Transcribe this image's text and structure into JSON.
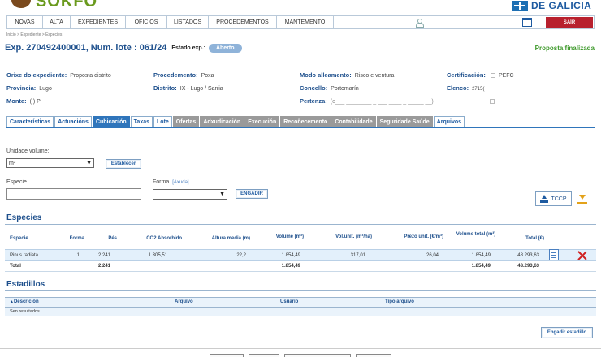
{
  "header": {
    "logo_left": "SOKFO",
    "logo_right": "DE GALICIA"
  },
  "menu": {
    "items": [
      "NOVAS",
      "ALTA",
      "EXPEDIENTES",
      "OFICIOS",
      "LISTADOS",
      "PROCEDEMENTOS",
      "MANTEMENTO"
    ],
    "logout": "SAÍR"
  },
  "breadcrumb": "Inicio > Expediente > Especies",
  "expediente": {
    "title": "Exp. 270492400001, Num. lote : 061/24",
    "estado_label": "Estado exp.:",
    "estado_value": "Aberto",
    "proposta": "Proposta finalizada"
  },
  "info": {
    "orixe_label": "Orixe do expediente:",
    "orixe_value": "Proposta distrito",
    "provincia_label": "Provincia:",
    "provincia_value": "Lugo",
    "monte_label": "Monte:",
    "monte_value": "(  ) P",
    "procedemento_label": "Procedemento:",
    "procedemento_value": "Poxa",
    "distrito_label": "Distrito:",
    "distrito_value": "IX - Lugo / Sarria",
    "modo_label": "Modo alleamento:",
    "modo_value": "Risco e ventura",
    "concello_label": "Concello:",
    "concello_value": "Portomarín",
    "pertenza_label": "Pertenza:",
    "pertenza_value": "(c___ ________ _ ___ ____ _ _____ __)",
    "certificacion_label": "Certificación:",
    "certificacion_value": "PEFC",
    "elenco_label": "Elenco:",
    "elenco_value": "2715("
  },
  "tabs": [
    {
      "label": "Características",
      "state": "link"
    },
    {
      "label": "Actuacións",
      "state": "link"
    },
    {
      "label": "Cubicación",
      "state": "active"
    },
    {
      "label": "Taxas",
      "state": "link"
    },
    {
      "label": "Lote",
      "state": "link"
    },
    {
      "label": "Ofertas",
      "state": "disabled"
    },
    {
      "label": "Adxudicación",
      "state": "disabled"
    },
    {
      "label": "Execución",
      "state": "disabled"
    },
    {
      "label": "Recoñecemento",
      "state": "disabled"
    },
    {
      "label": "Contabilidade",
      "state": "disabled"
    },
    {
      "label": "Seguridade Saúde",
      "state": "disabled"
    },
    {
      "label": "Arquivos",
      "state": "link"
    }
  ],
  "form": {
    "unidade_label": "Unidade volume:",
    "unidade_value": "m³",
    "establecer": "Establecer",
    "especie_label": "Especie",
    "forma_label": "Forma",
    "axuda": "[Axuda]",
    "engadir": "ENGADIR",
    "tccp": "TCCP"
  },
  "especies": {
    "title": "Especies",
    "headers": [
      "Especie",
      "Forma",
      "Pés",
      "CO2 Absorbido",
      "Altura media (m)",
      "Volume (m³)",
      "Vol.unit. (m³/ha)",
      "Prezo unit. (€/m³)",
      "Volume total (m³)",
      "Total (€)"
    ],
    "row": [
      "Pinus radiata",
      "1",
      "2.241",
      "1.305,51",
      "22,2",
      "1.854,49",
      "317,01",
      "26,04",
      "1.854,49",
      "48.293,63"
    ],
    "total": [
      "Total",
      "2.241",
      "1.854,49",
      "1.854,49",
      "48.293,63"
    ]
  },
  "estadillos": {
    "title": "Estadillos",
    "headers": [
      "Descrición",
      "Arquivo",
      "Usuario",
      "Tipo arquivo"
    ],
    "empty": "Sen resultados",
    "button": "Engadir estadillo"
  },
  "colors": {
    "primary": "#1d4f8c",
    "active_tab": "#2f75bb",
    "disabled_tab": "#9a9a9a",
    "logout": "#b8202e",
    "success": "#3f9a2c"
  }
}
